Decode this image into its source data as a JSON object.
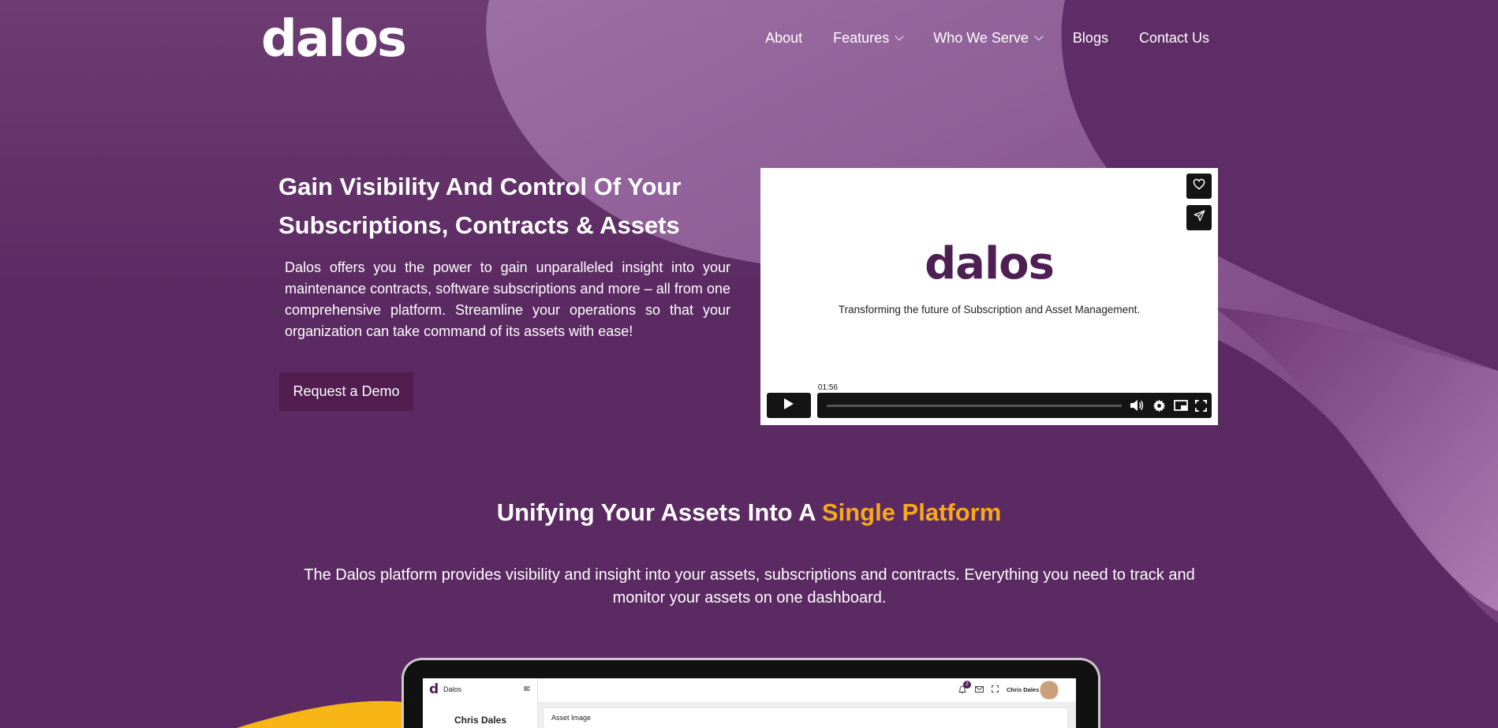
{
  "header": {
    "logo_text": "dalos",
    "nav": [
      {
        "label": "About"
      },
      {
        "label": "Features"
      },
      {
        "label": "Who We Serve"
      },
      {
        "label": "Blogs"
      },
      {
        "label": "Contact Us"
      }
    ]
  },
  "hero": {
    "title_line1": "Gain Visibility And Control Of Your",
    "title_line2": "Subscriptions, Contracts & Assets",
    "paragraph": "Dalos offers you the power to gain unparalleled insight into your maintenance contracts, software subscriptions and more – all from one comprehensive platform. Streamline your operations so that your organization can take command of its assets with ease!",
    "cta_label": "Request a Demo"
  },
  "video": {
    "logo_text": "dalos",
    "tagline": "Transforming the future of Subscription and Asset Management.",
    "duration": "01:56",
    "side_buttons": [
      "heart-icon",
      "send-icon"
    ],
    "controls": [
      "play-icon",
      "volume-icon",
      "settings-icon",
      "pip-icon",
      "fullscreen-icon"
    ]
  },
  "platform": {
    "title_part1": "Unifying Your Assets Into A ",
    "title_highlight": "Single Platform",
    "description": "The Dalos platform provides visibility and insight into your assets, subscriptions and contracts. Everything you need to track and monitor your assets on one dashboard."
  },
  "dashboard_preview": {
    "app_name": "Dalos",
    "app_logo_letter": "d",
    "user_name": "Chris Dales",
    "sidebar_user": "Chris Dales",
    "notification_count": "2",
    "card_title": "Asset Image"
  },
  "colors": {
    "background": "#5b2a62",
    "accent": "#f7a91c",
    "button": "#521d4f",
    "brand_dark": "#4e1f52"
  }
}
